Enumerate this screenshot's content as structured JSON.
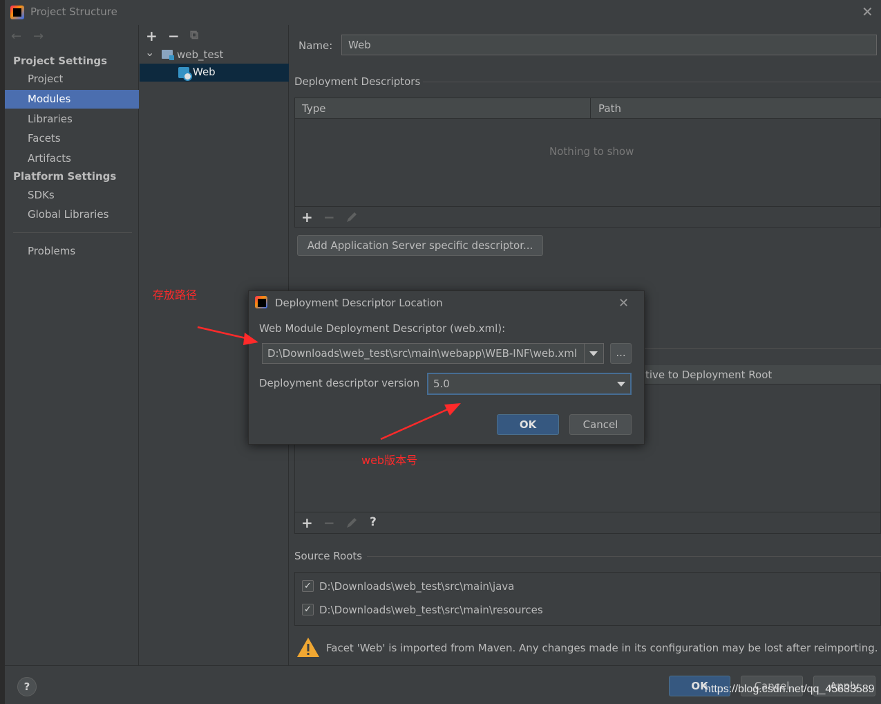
{
  "window": {
    "title": "Project Structure",
    "close_glyph": "✕"
  },
  "nav": {
    "back_glyph": "←",
    "forward_glyph": "→",
    "project_settings": "Project Settings",
    "project": "Project",
    "modules": "Modules",
    "libraries": "Libraries",
    "facets": "Facets",
    "artifacts": "Artifacts",
    "platform_settings": "Platform Settings",
    "sdks": "SDKs",
    "global_libraries": "Global Libraries",
    "problems": "Problems"
  },
  "tree_toolbar": {
    "add": "+",
    "remove": "−",
    "copy": "⧉"
  },
  "tree": {
    "expand_glyph": "⌄",
    "root": "web_test",
    "child": "Web"
  },
  "facet": {
    "name_label": "Name:",
    "name_value": "Web",
    "deployment_descriptors": "Deployment Descriptors",
    "col_type": "Type",
    "col_path": "Path",
    "empty": "Nothing to show",
    "add_server_descriptor": "Add Application Server specific descriptor...",
    "col_relative": "tive to Deployment Root",
    "help_glyph": "?",
    "source_roots": "Source Roots",
    "source_roots_items": [
      "D:\\Downloads\\web_test\\src\\main\\java",
      "D:\\Downloads\\web_test\\src\\main\\resources"
    ],
    "check_glyph": "✓",
    "warning": "Facet 'Web' is imported from Maven. Any changes made in its configuration may be lost after reimporting."
  },
  "footer": {
    "help_glyph": "?",
    "ok": "OK",
    "cancel": "Cancel",
    "apply": "Apply"
  },
  "dialog": {
    "title": "Deployment Descriptor Location",
    "close_glyph": "✕",
    "descriptor_label": "Web Module Deployment Descriptor (web.xml):",
    "descriptor_path": "D:\\Downloads\\web_test\\src\\main\\webapp\\WEB-INF\\web.xml",
    "browse": "...",
    "version_label": "Deployment descriptor version",
    "version_value": "5.0",
    "ok": "OK",
    "cancel": "Cancel"
  },
  "annotations": {
    "path_note": "存放路径",
    "version_note": "web版本号",
    "arrow_color": "#ff2a2a"
  },
  "watermark": "https://blog.csdn.net/qq_45633589",
  "colors": {
    "background": "#3c3f41",
    "selection": "#4b6eaf",
    "tree_selection": "#0d293e",
    "primary_button": "#365880",
    "warning": "#f0a732"
  }
}
